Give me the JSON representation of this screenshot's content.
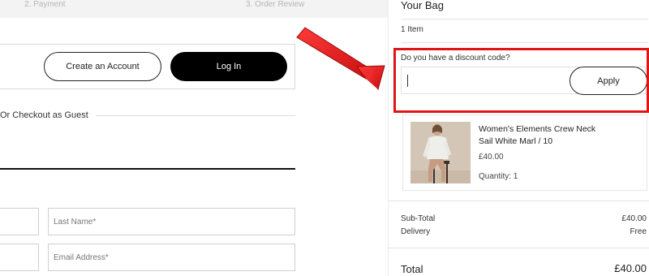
{
  "steps": {
    "payment": "2. Payment",
    "review": "3. Order Review"
  },
  "account": {
    "create_label": "Create an Account",
    "login_label": "Log In"
  },
  "guest": {
    "label": "Or Checkout as Guest"
  },
  "form": {
    "last_name_placeholder": "Last Name*",
    "email_placeholder": "Email Address*"
  },
  "bag": {
    "title": "Your Bag",
    "item_count": "1 Item",
    "discount_label": "Do you have a discount code?",
    "discount_value": "",
    "apply_label": "Apply",
    "product": {
      "name": "Women's Elements Crew Neck",
      "variant": "Sail White Marl / 10",
      "price": "£40.00",
      "quantity": "Quantity: 1"
    },
    "summary": {
      "subtotal_label": "Sub-Total",
      "subtotal_value": "£40.00",
      "delivery_label": "Delivery",
      "delivery_value": "Free",
      "total_label": "Total",
      "total_value": "£40.00"
    }
  },
  "colors": {
    "annotation_red": "#e01515",
    "login_button": "#000000",
    "steps_bar": "#f3f3f3"
  }
}
